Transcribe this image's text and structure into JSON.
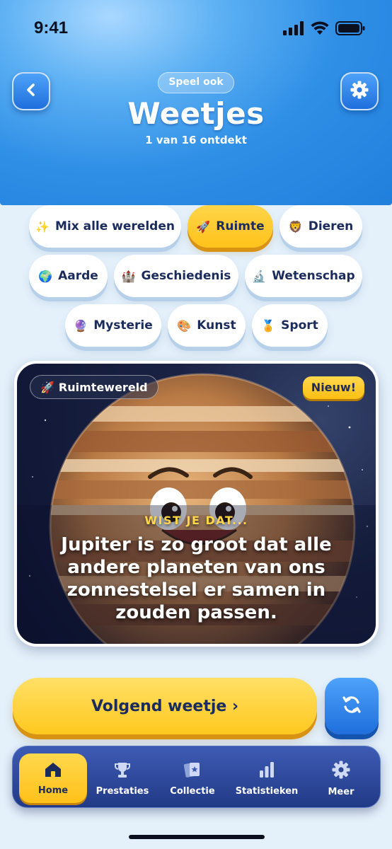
{
  "status": {
    "time": "9:41"
  },
  "header": {
    "pill": "Speel ook",
    "title": "Weetjes",
    "subtitle": "1 van 16 ontdekt"
  },
  "categories": [
    {
      "emoji": "✨",
      "label": "Mix alle werelden",
      "active": false
    },
    {
      "emoji": "🚀",
      "label": "Ruimte",
      "active": true
    },
    {
      "emoji": "🦁",
      "label": "Dieren",
      "active": false
    },
    {
      "emoji": "🌍",
      "label": "Aarde",
      "active": false
    },
    {
      "emoji": "🏰",
      "label": "Geschiedenis",
      "active": false
    },
    {
      "emoji": "🔬",
      "label": "Wetenschap",
      "active": false
    },
    {
      "emoji": "🔮",
      "label": "Mysterie",
      "active": false
    },
    {
      "emoji": "🎨",
      "label": "Kunst",
      "active": false
    },
    {
      "emoji": "🏅",
      "label": "Sport",
      "active": false
    }
  ],
  "card": {
    "tag_emoji": "🚀",
    "tag": "Ruimtewereld",
    "badge": "Nieuw!",
    "kicker": "WIST JE DAT...",
    "fact": "Jupiter is zo groot dat alle andere planeten van ons zonnestelsel er samen in zouden passen."
  },
  "actions": {
    "next": "Volgend weetje ›"
  },
  "tabs": [
    {
      "label": "Home",
      "icon": "home-icon",
      "active": true
    },
    {
      "label": "Prestaties",
      "icon": "trophy-icon",
      "active": false
    },
    {
      "label": "Collectie",
      "icon": "cards-icon",
      "active": false
    },
    {
      "label": "Statistieken",
      "icon": "bar-chart-icon",
      "active": false
    },
    {
      "label": "Meer",
      "icon": "gear-icon",
      "active": false
    }
  ],
  "colors": {
    "accent_yellow": "#ffc81f",
    "primary_blue": "#2f8fe6",
    "navy": "#1a2b5c"
  }
}
